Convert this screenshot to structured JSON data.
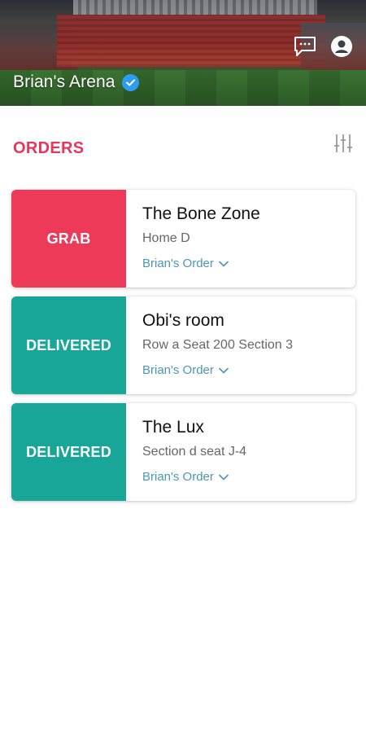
{
  "header": {
    "venue_name": "Brian's Arena",
    "verified_icon": "verified-check-icon",
    "chat_icon": "chat-bubble-icon",
    "profile_icon": "account-icon"
  },
  "orders_section": {
    "title": "ORDERS",
    "filter_icon": "sliders-filter-icon"
  },
  "colors": {
    "accent": "#e8355b",
    "grab": "#ee3a59",
    "delivered": "#17a697",
    "link": "#4a97b8",
    "verified": "#2f9cf0"
  },
  "orders": [
    {
      "status": "GRAB",
      "title": "The Bone Zone",
      "location": "Home D",
      "owner": "Brian's Order"
    },
    {
      "status": "DELIVERED",
      "title": "Obi's room",
      "location": "Row a Seat 200 Section 3",
      "owner": "Brian's Order"
    },
    {
      "status": "DELIVERED",
      "title": "The Lux",
      "location": "Section d seat J-4",
      "owner": "Brian's Order"
    }
  ]
}
